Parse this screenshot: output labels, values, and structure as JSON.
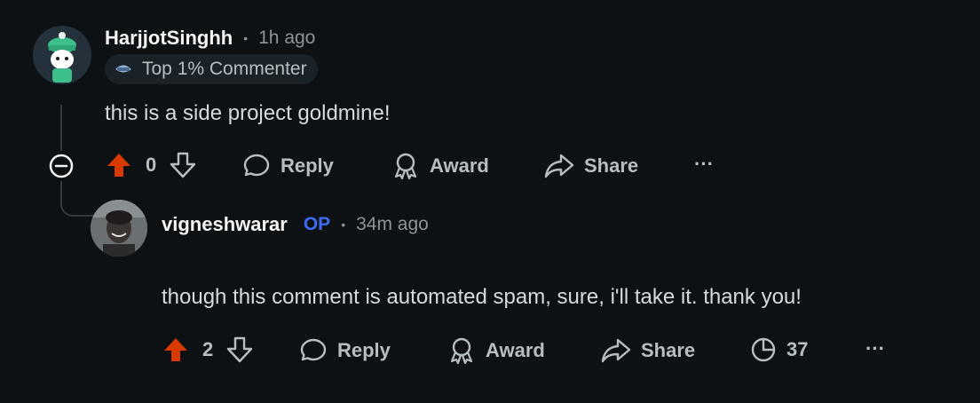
{
  "comments": [
    {
      "username": "HarjjotSinghh",
      "time": "1h ago",
      "badge": "Top 1% Commenter",
      "body": "this is a side project goldmine!",
      "votes": "0",
      "actions": {
        "reply": "Reply",
        "award": "Award",
        "share": "Share"
      },
      "more": "···"
    },
    {
      "username": "vigneshwarar",
      "op_label": "OP",
      "time": "34m ago",
      "body": "though this comment is automated spam, sure, i'll take it. thank you!",
      "votes": "2",
      "actions": {
        "reply": "Reply",
        "award": "Award",
        "share": "Share",
        "insights_count": "37"
      },
      "more": "···"
    }
  ],
  "separator": "•",
  "colors": {
    "upvote_active": "#d93900",
    "op": "#3d6bf0",
    "background": "#0e1113"
  }
}
